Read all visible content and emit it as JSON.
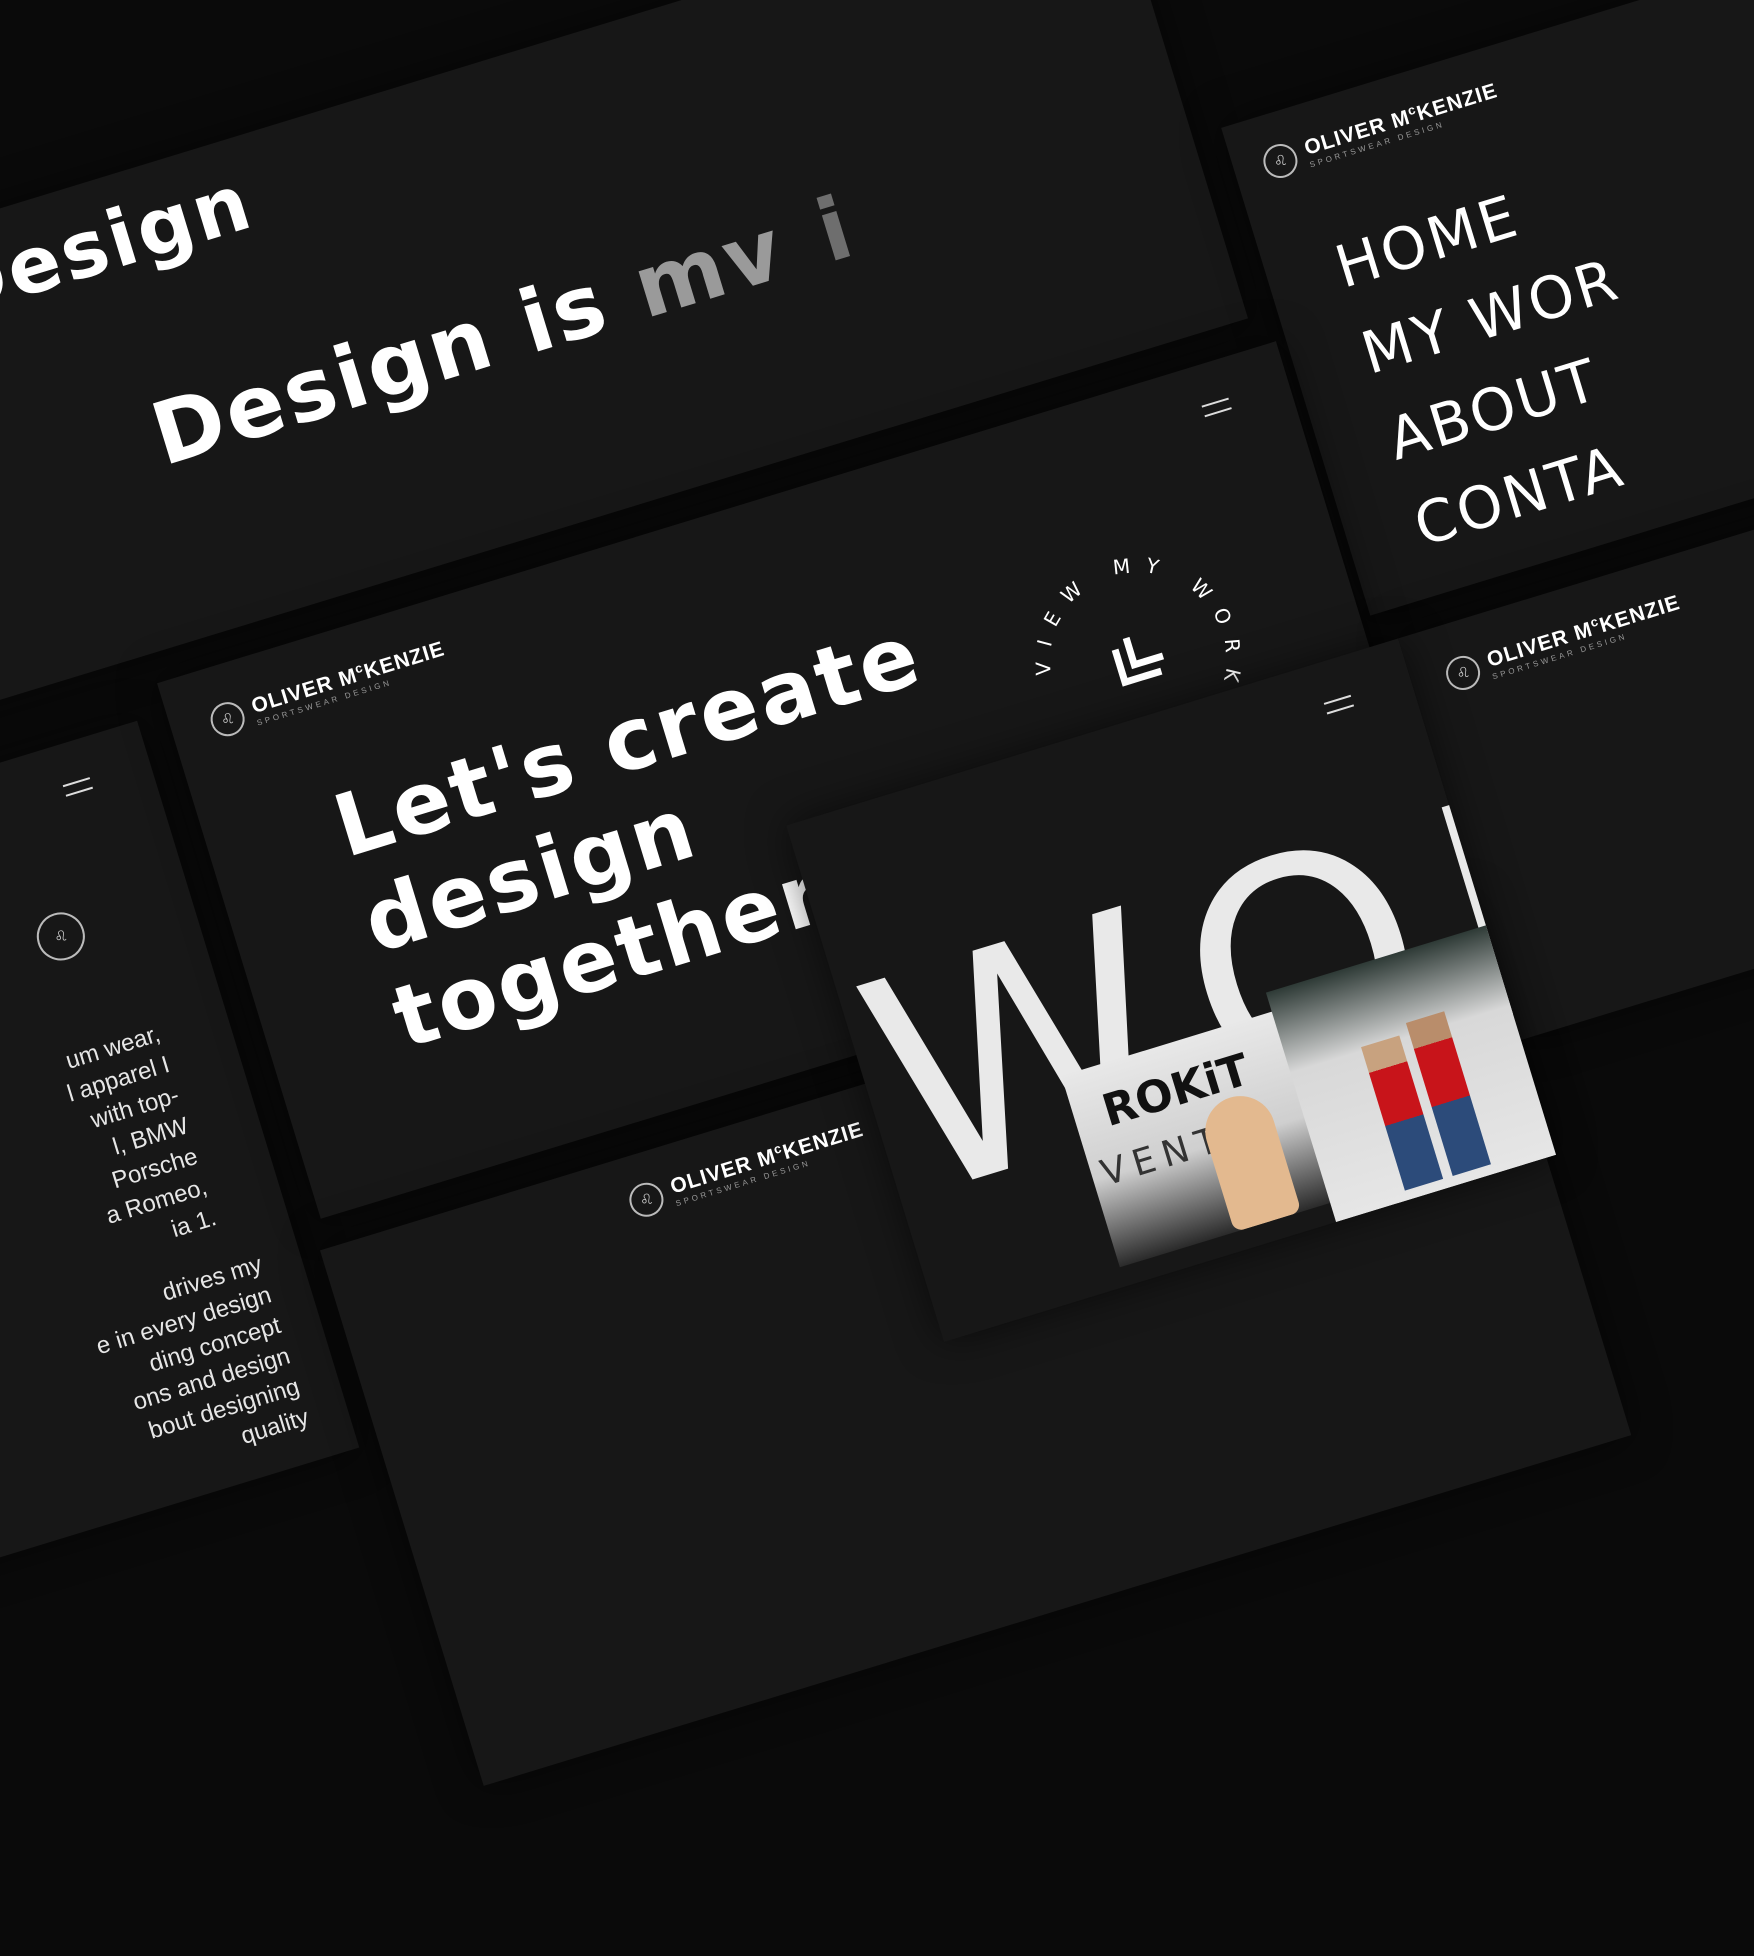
{
  "logo": {
    "name": "OLIVER M",
    "name_sup": "c",
    "name_end": "KENZIE",
    "subtitle": "SPORTSWEAR DESIGN"
  },
  "headline_top": {
    "line1": "Design",
    "line2_part1": "Design is ",
    "line2_part2": "mv",
    "line2_part3": "i"
  },
  "hero": {
    "line1": "Let's create",
    "line2": "design",
    "line3": "together"
  },
  "view_works_badge": {
    "text": "VIEW MY WORKS",
    "arrow_icon": "double-chevron-down-icon"
  },
  "nav_menu": {
    "items": [
      "HOME",
      "MY WOR",
      "ABOUT",
      "CONTA"
    ]
  },
  "about": {
    "paragraph1": [
      "um wear,",
      "l apparel I",
      "with top-",
      "l, BMW",
      "Porsche",
      "a Romeo,",
      "ia 1."
    ],
    "paragraph2": [
      "drives my",
      "e in every design",
      "ding concept",
      "ons and design",
      "bout designing",
      "quality"
    ]
  },
  "works": {
    "title": "MY WORK",
    "title_visible": "WORI"
  },
  "photos": {
    "rokit_brand": "ROKiT",
    "rokit_sub": "VENTF"
  },
  "colors": {
    "background": "#171717",
    "text": "#ffffff",
    "accent_grey": "#9a9a9a"
  }
}
